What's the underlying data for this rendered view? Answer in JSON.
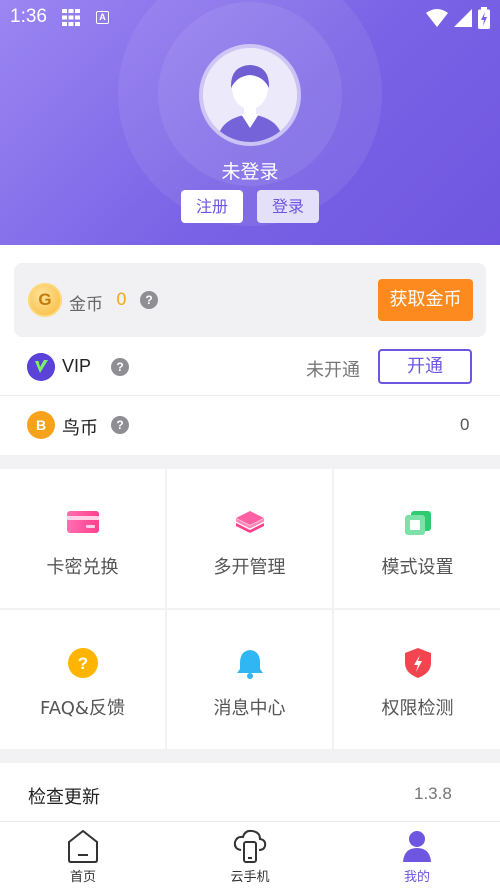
{
  "status_bar": {
    "time": "1:36",
    "icons": [
      "grid-icon",
      "font-app-icon",
      "wifi-icon",
      "signal-icon",
      "battery-icon"
    ]
  },
  "profile": {
    "username": "未登录",
    "register_label": "注册",
    "login_label": "登录"
  },
  "coins": {
    "icon_letter": "G",
    "label": "金币",
    "value": "0",
    "get_button": "获取金币"
  },
  "vip": {
    "label": "VIP",
    "status": "未开通",
    "open_button": "开通"
  },
  "bird_coin": {
    "icon_letter": "B",
    "label": "鸟币",
    "value": "0"
  },
  "grid_items": [
    {
      "label": "卡密兑换",
      "icon": "card-icon"
    },
    {
      "label": "多开管理",
      "icon": "layers-icon"
    },
    {
      "label": "模式设置",
      "icon": "mode-icon"
    },
    {
      "label": "FAQ&反馈",
      "icon": "question-icon"
    },
    {
      "label": "消息中心",
      "icon": "bell-icon"
    },
    {
      "label": "权限检测",
      "icon": "shield-icon"
    }
  ],
  "update": {
    "label": "检查更新",
    "version": "1.3.8"
  },
  "tabs": [
    {
      "label": "首页",
      "icon": "home-icon",
      "active": false
    },
    {
      "label": "云手机",
      "icon": "cloud-phone-icon",
      "active": false
    },
    {
      "label": "我的",
      "icon": "profile-icon",
      "active": true
    }
  ],
  "colors": {
    "accent": "#6f56e0",
    "orange": "#fd8a1e",
    "coin_value": "#f5a623"
  }
}
